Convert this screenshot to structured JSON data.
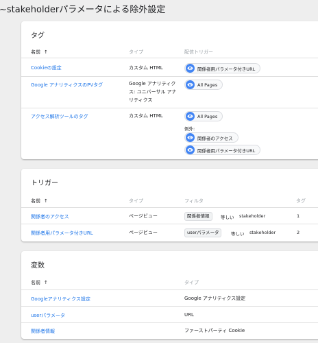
{
  "page": {
    "title": "~stakeholderパラメータによる除外設定"
  },
  "tags": {
    "title": "タグ",
    "columns": {
      "name": "名前",
      "type": "タイプ",
      "trigger": "配信トリガー"
    },
    "rows": [
      {
        "name": "Cookieの設定",
        "type": "カスタム HTML",
        "triggers": [
          "関係者用パラメータ付きURL"
        ]
      },
      {
        "name": "Google アナリティクスのPVタグ",
        "type_lines": [
          "Google アナリティク",
          "ス: ユニバーサル アナ",
          "リティクス"
        ],
        "triggers": [
          "All Pages"
        ]
      },
      {
        "name": "アクセス解析ツールのタグ",
        "type": "カスタム HTML",
        "triggers": [
          "All Pages"
        ],
        "exception_label": "例外:",
        "exceptions": [
          "関係者のアクセス",
          "関係者用パラメータ付きURL"
        ]
      }
    ]
  },
  "triggers": {
    "title": "トリガー",
    "columns": {
      "name": "名前",
      "type": "タイプ",
      "filter": "フィルタ",
      "tags": "タグ"
    },
    "rows": [
      {
        "name": "関係者のアクセス",
        "type": "ページビュー",
        "filter_var": "関係者情報",
        "filter_op": "等しい",
        "filter_val": "stakeholder",
        "tags": "1"
      },
      {
        "name": "関係者用パラメータ付きURL",
        "type": "ページビュー",
        "filter_var": "userパラメータ",
        "filter_op": "等しい",
        "filter_val": "stakeholder",
        "tags": "2"
      }
    ]
  },
  "variables": {
    "title": "変数",
    "columns": {
      "name": "名前",
      "type": "タイプ"
    },
    "rows": [
      {
        "name": "Googleアナリティクス設定",
        "type": "Google アナリティクス設定"
      },
      {
        "name": "userパラメータ",
        "type": "URL"
      },
      {
        "name": "関係者情報",
        "type": "ファーストパーティ Cookie"
      }
    ]
  },
  "icons": {
    "sort": "arrow-up-icon",
    "trigger": "eye-icon"
  },
  "colors": {
    "link": "#1a73e8",
    "trigger_icon": "#4285f4",
    "background": "#eeeeee",
    "card": "#ffffff"
  }
}
